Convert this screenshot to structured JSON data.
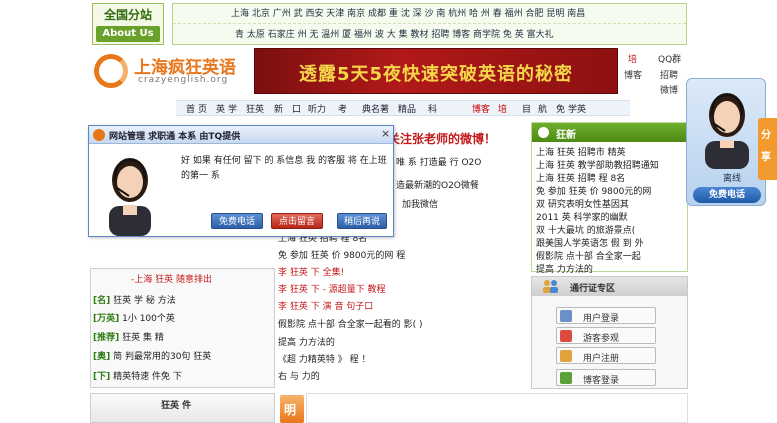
{
  "branch": {
    "title": "全国分站",
    "about": "About Us"
  },
  "cities": {
    "row1": "上海 北京 广州 武    西安 天津 南京 成都 重    沈    深    沙    南 杭州 哈    州  春 福州 合肥 昆明 南昌",
    "row2": "青    太原 石家庄    州 无    溫州       厦    福州    波 大    集      教材 招聘      博客 商学院 免    英       富大礼"
  },
  "logo": {
    "cn": "上海疯狂英语",
    "en": "crazyenglish.org"
  },
  "banner": {
    "text": "透露5天5夜快速突破英语的秘密"
  },
  "right_links": {
    "a": "培",
    "b": "博客",
    "c": "QQ群",
    "d": "招聘",
    "e": "微博"
  },
  "nav": [
    "首",
    "页",
    "英",
    "学",
    "狂英",
    "新",
    "口",
    "听力",
    "考",
    "典名著",
    "精品",
    "科",
    "博客",
    "培",
    "目",
    "航",
    "免",
    "学英"
  ],
  "headline": "关注张老师的微博！",
  "main_list": [
    "唯  系  打造最  行  O2O",
    "造最新潮的O2O微餐",
    "加我微信",
    "上海  狂英  招聘  程    8名",
    "免  参加  狂英  价  9800元的网    程",
    "李    狂英  下  全集!",
    "李    狂英  下  -  源超量下  教程",
    "李    狂英  下        演    音  句子口",
    "假影院  点十部  合全家一起看的  影(   )",
    "提高    力方法的",
    "《超    力精英特    》  程  ！",
    "右    与    力的"
  ],
  "news": {
    "title": "狂新",
    "items": [
      "上海  狂英  招聘市      精英",
      "上海  狂英  教学部助教招聘通知",
      "上海  狂英  招聘  程    8名",
      "免  参加  狂英  价  9800元的网",
      "双      研究表明女性基因其",
      "2011  英        科学家的幽默",
      "双    十大最坑  的旅游景点(",
      "跟美国人学英语怎    假  到  外",
      "假影院    点十部  合全家一起",
      "提高      力方法的"
    ]
  },
  "pass_zone": {
    "title": "通行证专区",
    "buttons": [
      "用户登录",
      "游客参观",
      "用户注册",
      "博客登录"
    ]
  },
  "left_panel": {
    "title": "-上海  狂英  随意排出",
    "items": [
      {
        "tag": "[名]",
        "text": "狂英  学  秘  方法"
      },
      {
        "tag": "[万英]",
        "text": "1小    100个英"
      },
      {
        "tag": "[推荐]",
        "text": "狂英    集    精"
      },
      {
        "tag": "[奥]",
        "text": "简    判最常用的30句  狂英"
      },
      {
        "tag": "[下]",
        "text": "精英特速        件免  下"
      }
    ],
    "footer": "狂英    件"
  },
  "ming": "明",
  "popup": {
    "title": "网站管理    求职通    本系    由TQ提供",
    "close": "×",
    "message": "好  如果  有任何      留下  的  系信息  我  的客服  将   在上班的第一      系",
    "free_call": "免费电话",
    "leave_msg": "点击留言",
    "later": "稍后再说"
  },
  "service": {
    "label": "离线",
    "call": "免费电话"
  },
  "share": [
    "分",
    "享"
  ]
}
